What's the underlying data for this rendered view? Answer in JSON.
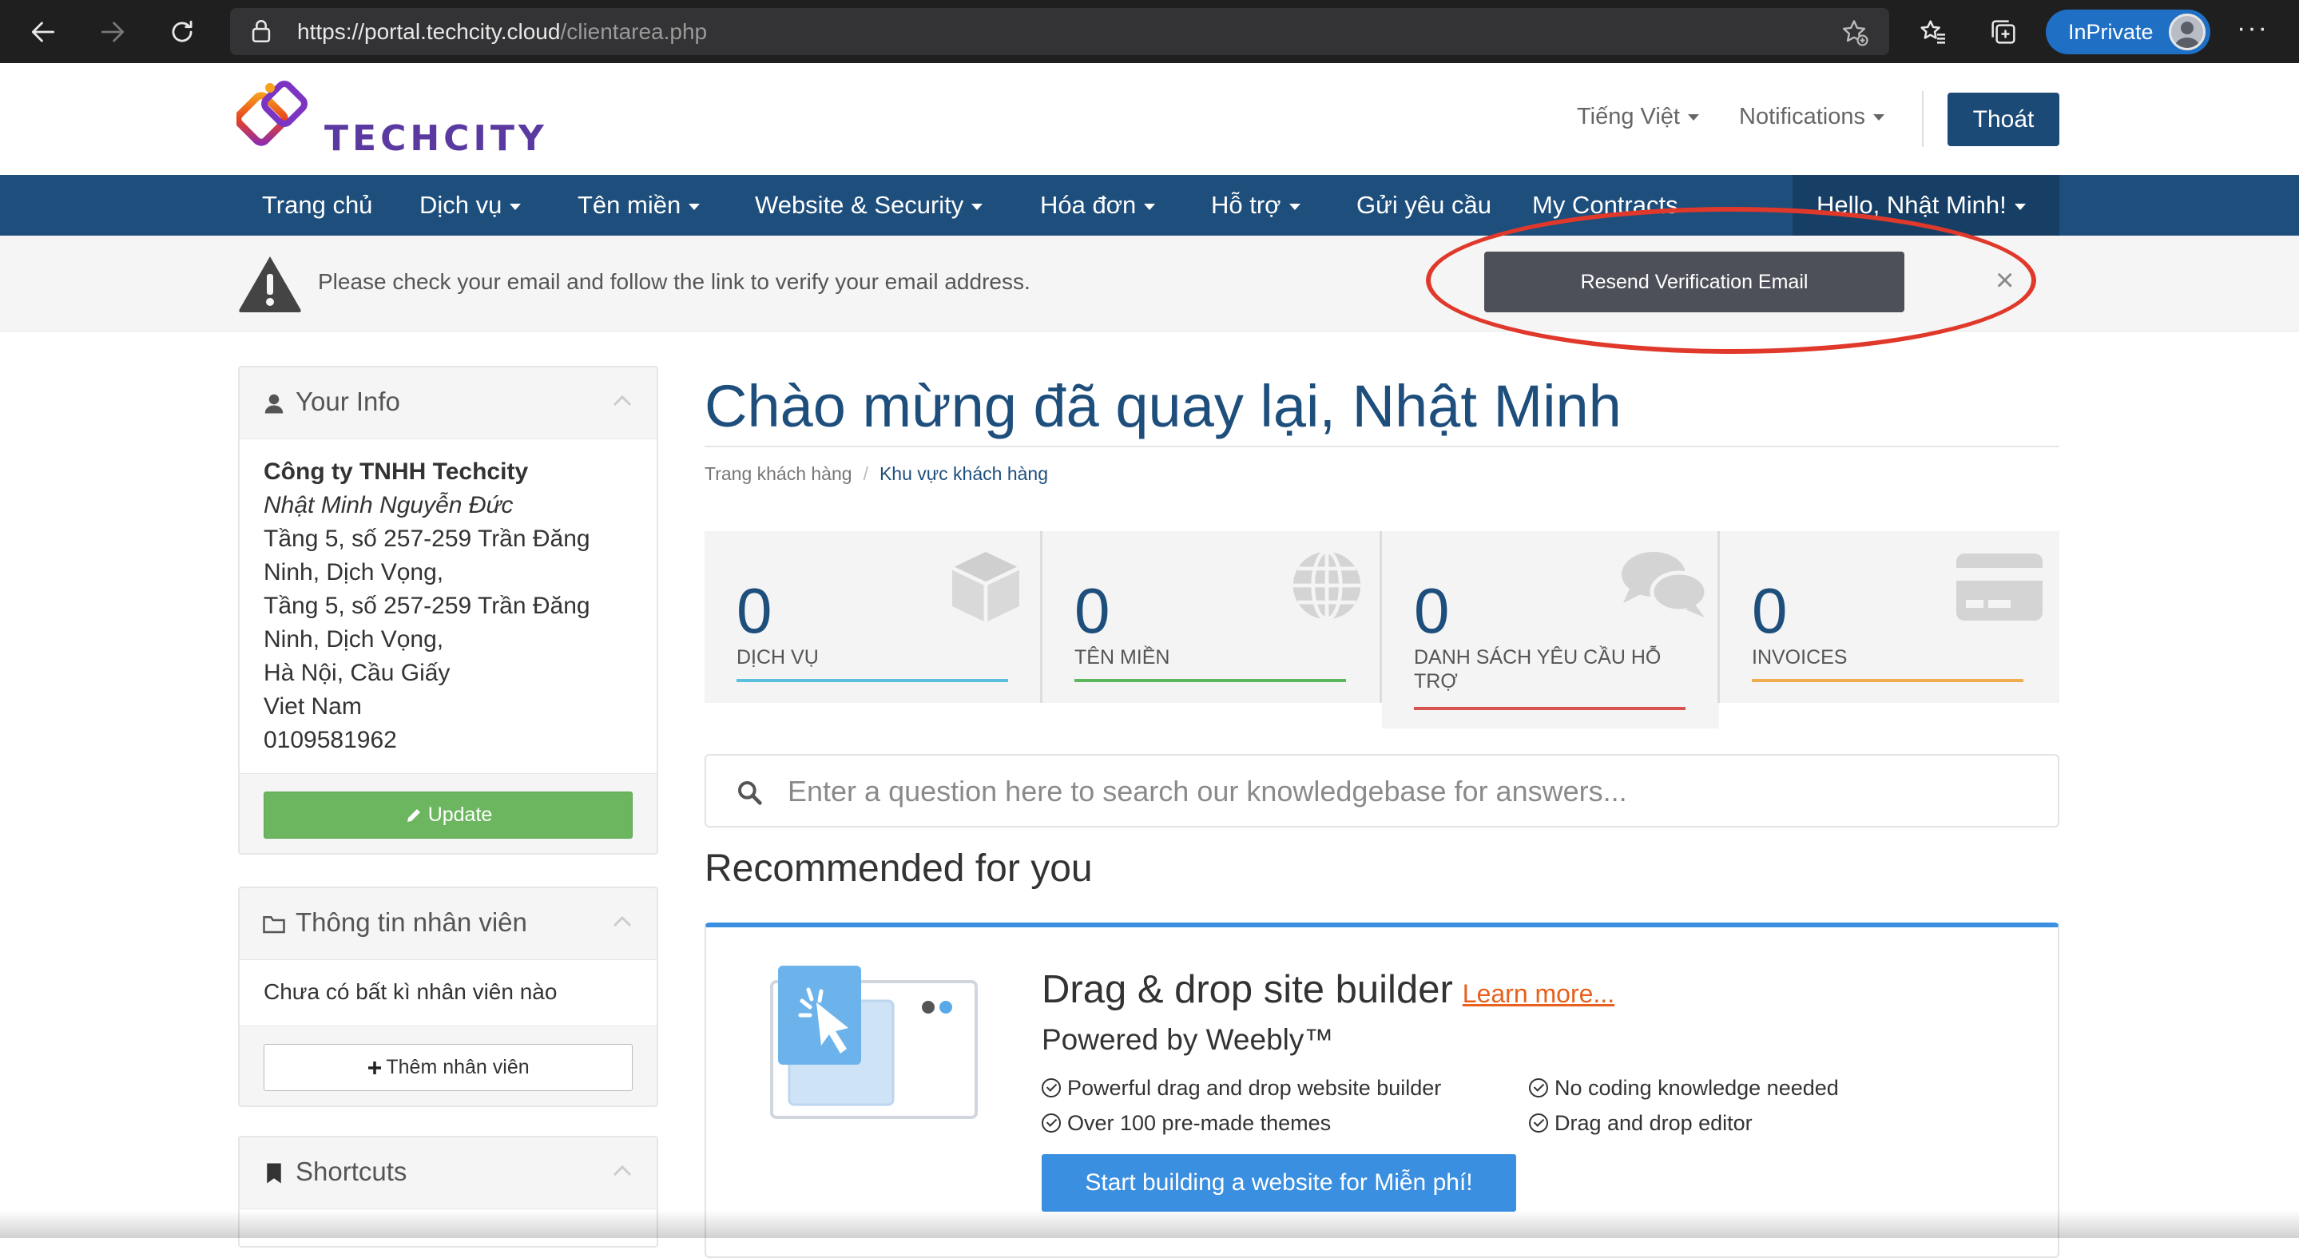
{
  "browser": {
    "url_host": "https://portal.techcity.cloud",
    "url_path": "/clientarea.php",
    "inprivate_label": "InPrivate",
    "more_label": "···"
  },
  "header": {
    "logo_text": "TECHCITY",
    "language": "Tiếng Việt",
    "notifications": "Notifications",
    "logout": "Thoát"
  },
  "nav": {
    "items": [
      "Trang chủ",
      "Dịch vụ",
      "Tên miền",
      "Website & Security",
      "Hóa đơn",
      "Hỗ trợ",
      "Gửi yêu cầu",
      "My Contracts"
    ],
    "hello": "Hello, Nhật Minh!"
  },
  "alert": {
    "text": "Please check your email and follow the link to verify your email address.",
    "button": "Resend Verification Email",
    "close": "×",
    "highlight_color": "#e0392b"
  },
  "your_info": {
    "title": "Your Info",
    "company": "Công ty TNHH Techcity",
    "name": "Nhật Minh Nguyễn Đức",
    "address_lines": [
      "Tầng 5, số 257-259 Trần Đăng",
      "Ninh, Dịch Vọng,",
      "Tầng 5, số 257-259 Trần Đăng",
      "Ninh, Dịch Vọng,",
      "Hà Nội, Cầu Giấy",
      "Viet Nam",
      "0109581962"
    ],
    "update_button": "Update"
  },
  "staff": {
    "title": "Thông tin nhân viên",
    "empty_text": "Chưa có bất kì nhân viên nào",
    "add_button": "Thêm nhân viên"
  },
  "shortcuts": {
    "title": "Shortcuts"
  },
  "main": {
    "welcome": "Chào mừng đã quay lại, Nhật Minh",
    "breadcrumb": [
      "Trang khách hàng",
      "Khu vực khách hàng"
    ],
    "tiles": [
      {
        "count": "0",
        "label": "DỊCH VỤ",
        "color": "#5bc0de",
        "icon": "cube-icon"
      },
      {
        "count": "0",
        "label": "TÊN MIỀN",
        "color": "#5cb85c",
        "icon": "globe-icon"
      },
      {
        "count": "0",
        "label": "DANH SÁCH YÊU CẦU HỖ TRỢ",
        "color": "#d9534f",
        "icon": "comments-icon"
      },
      {
        "count": "0",
        "label": "INVOICES",
        "color": "#f0ad4e",
        "icon": "credit-card-icon"
      }
    ],
    "kb_placeholder": "Enter a question here to search our knowledgebase for answers...",
    "recommended_title": "Recommended for you",
    "promo": {
      "heading": "Drag & drop site builder",
      "learn_more": "Learn more...",
      "subheading": "Powered by Weebly™",
      "features": [
        "Powerful drag and drop website builder",
        "Over 100 pre-made themes",
        "No coding knowledge needed",
        "Drag and drop editor"
      ],
      "cta": "Start building a website for Miễn phí!"
    }
  }
}
